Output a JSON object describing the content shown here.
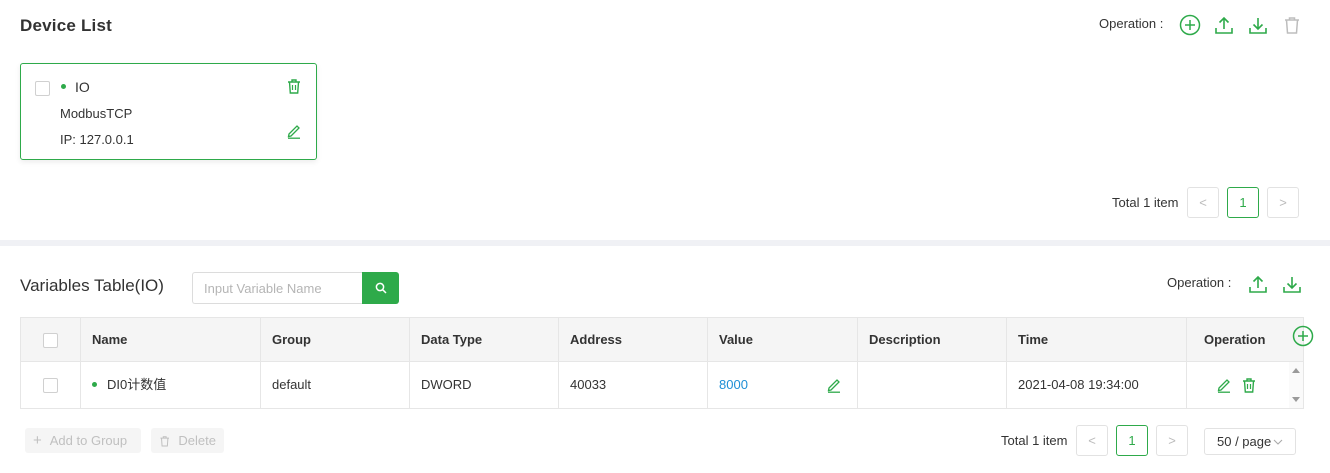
{
  "device_list": {
    "title": "Device List",
    "operation_label": "Operation :",
    "operation_icons": [
      "add-circle-icon",
      "upload-icon",
      "download-icon",
      "trash-icon"
    ],
    "devices": [
      {
        "name": "IO",
        "protocol": "ModbusTCP",
        "ip": "IP: 127.0.0.1",
        "status_color": "#2eaa4a"
      }
    ],
    "pagination": {
      "total": "Total 1 item",
      "current_page": "1",
      "prev": "<",
      "next": ">"
    }
  },
  "variables": {
    "title": "Variables Table(IO)",
    "search": {
      "placeholder": "Input Variable Name",
      "icon": "search-icon"
    },
    "operation_label": "Operation :",
    "operation_icons": [
      "upload-icon",
      "download-icon"
    ],
    "columns": [
      "Name",
      "Group",
      "Data Type",
      "Address",
      "Value",
      "Description",
      "Time",
      "Operation"
    ],
    "rows": [
      {
        "name": "DI0计数值",
        "group": "default",
        "data_type": "DWORD",
        "address": "40033",
        "value": "8000",
        "description": "",
        "time": "2021-04-08 19:34:00"
      }
    ],
    "bulk_actions": {
      "add_to_group": "Add to Group",
      "delete": "Delete"
    },
    "pagination": {
      "total": "Total 1 item",
      "current_page": "1",
      "page_size": "50 / page",
      "prev": "<",
      "next": ">"
    }
  },
  "colors": {
    "accent": "#2eaa4a",
    "link": "#1e8fd6",
    "disabled": "#c0c0c0"
  }
}
